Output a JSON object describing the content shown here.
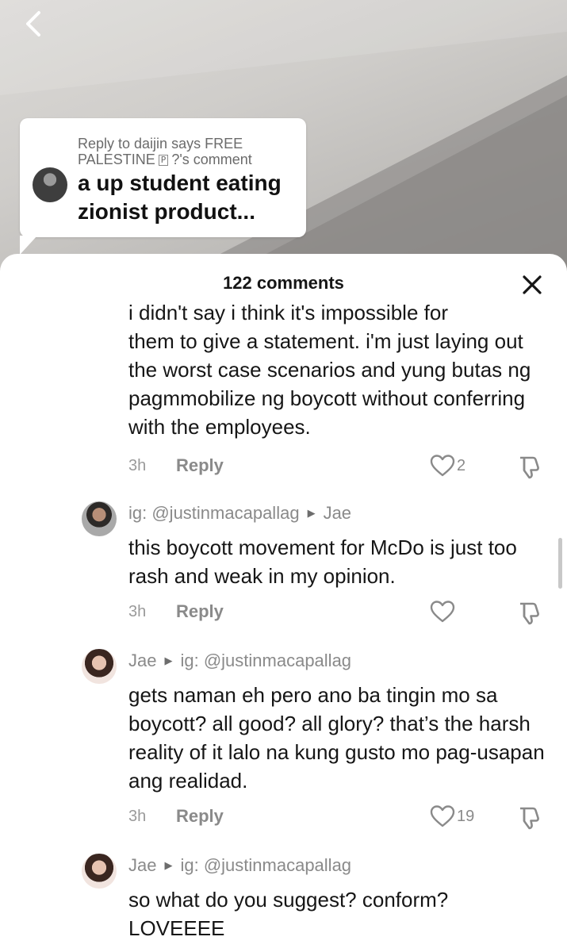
{
  "video": {
    "reply_card": {
      "context_prefix": "Reply to daijin says FREE PALESTINE",
      "context_badge": "P",
      "context_suffix": "?'s comment",
      "text": "a up student eating zionist product..."
    }
  },
  "sheet": {
    "title": "122 comments"
  },
  "comments": [
    {
      "text_partial_top": "i didn't say i think it's impossible for",
      "text": "them to give a statement. i'm just laying out the worst case scenarios and yung butas ng pagmmobilize ng boycott without conferring with the employees.",
      "time": "3h",
      "reply_label": "Reply",
      "likes": "2"
    },
    {
      "author": "ig: @justinmacapallag",
      "reply_to": "Jae",
      "text": "this boycott movement for McDo is just too rash and weak in my opinion.",
      "time": "3h",
      "reply_label": "Reply",
      "likes": ""
    },
    {
      "author": "Jae",
      "reply_to": "ig: @justinmacapallag",
      "text": "gets naman eh pero ano ba tingin mo sa boycott? all good? all glory? that’s the harsh reality of it lalo na kung gusto mo pag-usapan ang realidad.",
      "time": "3h",
      "reply_label": "Reply",
      "likes": "19"
    },
    {
      "author": "Jae",
      "reply_to": "ig: @justinmacapallag",
      "text": "so what do you suggest? conform? LOVEEEE"
    }
  ],
  "icons": {
    "back": "chevron-left-icon",
    "close": "close-icon",
    "like": "heart-outline-icon",
    "dislike": "thumbs-down-icon"
  },
  "colors": {
    "text_primary": "#161616",
    "text_secondary": "#8a8a8a",
    "sheet_bg": "#ffffff"
  }
}
